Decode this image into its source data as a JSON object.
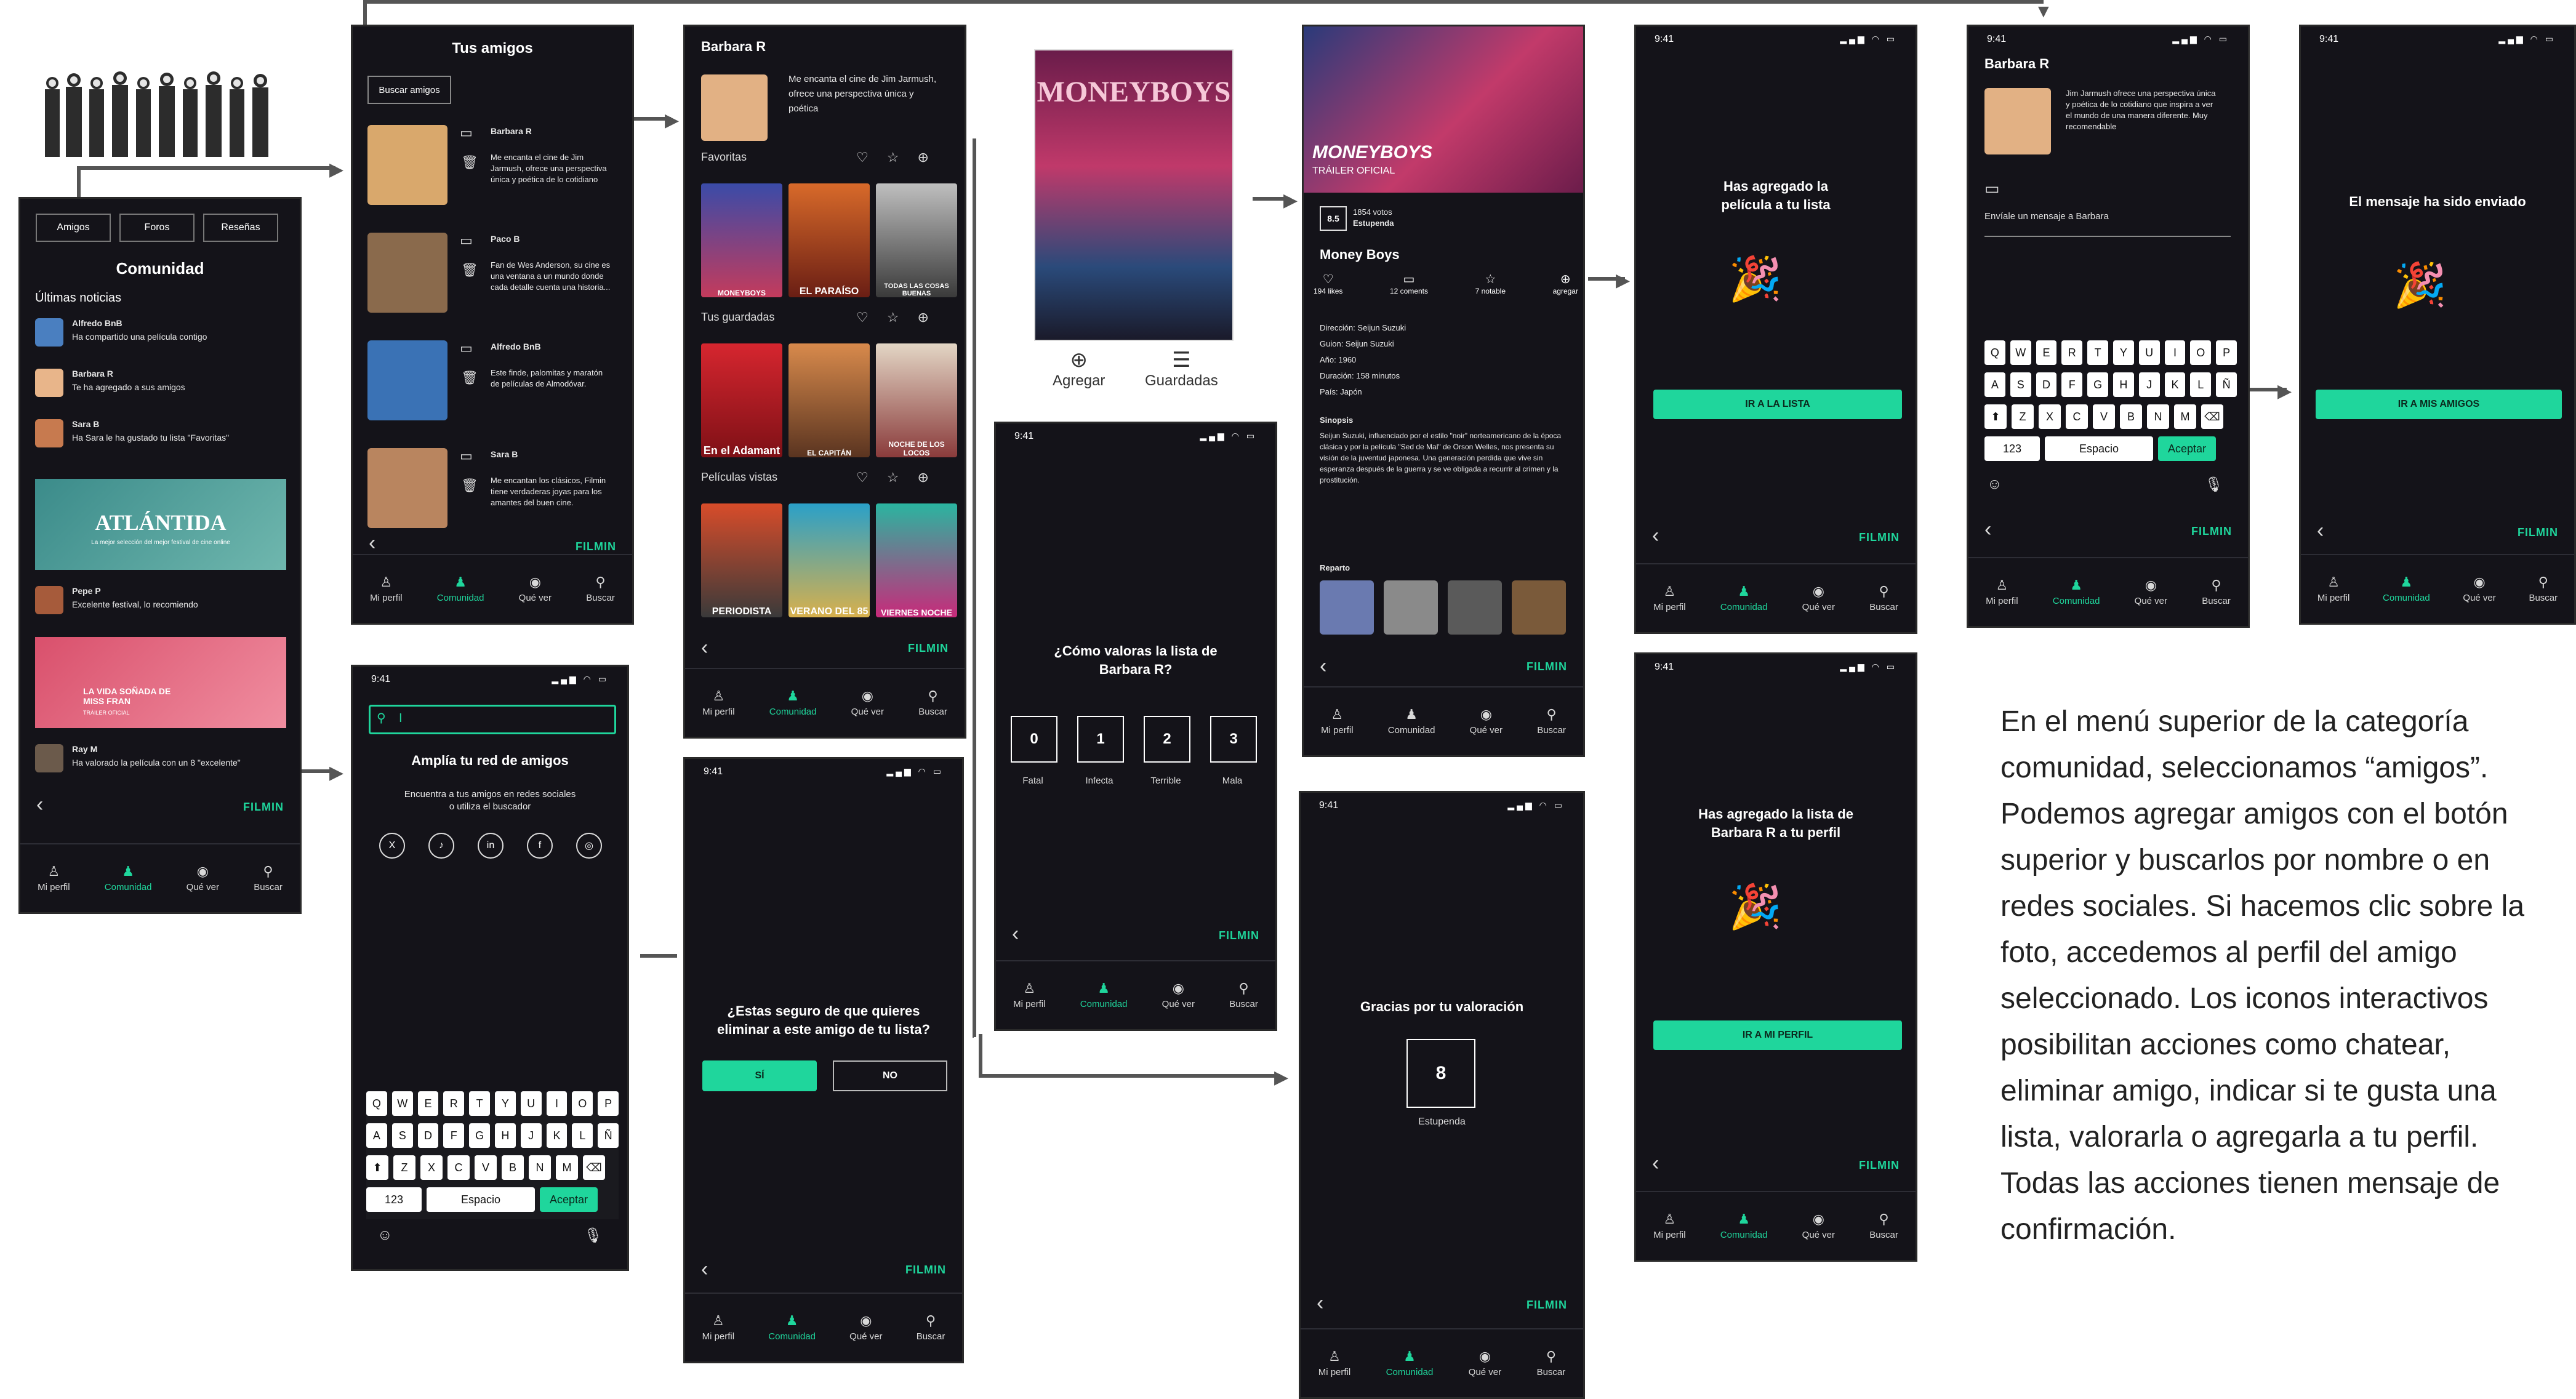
{
  "screen_main": {
    "tabs": [
      "Amigos",
      "Foros",
      "Reseñas"
    ],
    "title": "Comunidad",
    "subtitle": "Últimas noticias",
    "news": [
      {
        "name": "Alfredo BnB",
        "text": "Ha compartido una película contigo"
      },
      {
        "name": "Barbara R",
        "text": "Te ha agregado a sus amigos"
      },
      {
        "name": "Sara B",
        "text": "Ha Sara le ha gustado tu lista \"Favoritas\""
      }
    ],
    "banner1": "ATLÁNTIDA",
    "banner1_sub": "La mejor selección del mejor festival de cine online",
    "news2": {
      "name": "Pepe P",
      "text": "Excelente festival, lo recomiendo"
    },
    "banner2": "LA VIDA SOÑADA DE MISS FRAN",
    "banner2_sub": "TRÁILER OFICIAL",
    "news3": {
      "name": "Ray M",
      "text": "Ha valorado la película con un 8 \"excelente\""
    }
  },
  "nav": {
    "perfil": "Mi perfil",
    "comunidad": "Comunidad",
    "quever": "Qué ver",
    "buscar": "Buscar"
  },
  "nav_icons": {
    "perfil": "person-icon",
    "comunidad": "group-icon",
    "quever": "eye-icon",
    "buscar": "search-icon"
  },
  "brand": "FILMIN",
  "friends": {
    "title": "Tus amigos",
    "search": "Buscar amigos",
    "list": [
      {
        "name": "Barbara R",
        "text": "Me encanta el cine de Jim Jarmush, ofrece una perspectiva única y poética de lo cotidiano"
      },
      {
        "name": "Paco B",
        "text": "Fan de Wes Anderson, su cine es una ventana a un mundo donde cada detalle cuenta una historia..."
      },
      {
        "name": "Alfredo BnB",
        "text": "Este finde, palomitas y maratón de películas de Almodóvar."
      },
      {
        "name": "Sara B",
        "text": "Me encantan los clásicos, Filmin tiene verdaderas joyas para los amantes del buen cine."
      }
    ]
  },
  "add_friends": {
    "time": "9:41",
    "input": "I",
    "title": "Amplía tu red de amigos",
    "text": "Encuentra a tus amigos en redes sociales o utiliza el buscador",
    "keys_row1": [
      "Q",
      "W",
      "E",
      "R",
      "T",
      "Y",
      "U",
      "I",
      "O",
      "P"
    ],
    "keys_row2": [
      "A",
      "S",
      "D",
      "F",
      "G",
      "H",
      "J",
      "K",
      "L",
      "Ñ"
    ],
    "keys_row3": [
      "Z",
      "X",
      "C",
      "V",
      "B",
      "N",
      "M"
    ],
    "k123": "123",
    "kspace": "Espacio",
    "kok": "Aceptar"
  },
  "profile": {
    "name": "Barbara R",
    "bio": "Me encanta el cine de Jim Jarmush, ofrece una perspectiva única y poética",
    "favoritas": "Favoritas",
    "guardadas": "Tus guardadas",
    "vistas": "Películas vistas",
    "posters_fav": [
      "MONEYBOYS",
      "EL PARAÍSO",
      "TODAS LAS COSAS BUENAS"
    ],
    "posters_sav": [
      "En el Adamant",
      "EL CAPITÁN",
      "NOCHE DE LOS LOCOS"
    ],
    "posters_vis": [
      "PERIODISTA",
      "VERANO DEL 85",
      "VIERNES NOCHE"
    ]
  },
  "delete": {
    "time": "9:41",
    "question": "¿Estas seguro de que quieres eliminar a este amigo de tu lista?",
    "yes": "SÍ",
    "no": "NO"
  },
  "poster_big": {
    "title": "MONEYBOYS",
    "add": "Agregar",
    "saved": "Guardadas"
  },
  "rate_list": {
    "time": "9:41",
    "question": "¿Cómo valoras la lista de Barbara R?",
    "values": [
      "0",
      "1",
      "2",
      "3"
    ],
    "labels": [
      "Fatal",
      "Infecta",
      "Terrible",
      "Mala"
    ]
  },
  "movie": {
    "poster_title": "MONEYBOYS",
    "trailer": "TRÁILER OFICIAL",
    "score": "8.5",
    "votes": "1854 votos",
    "verdict": "Estupenda",
    "title": "Money Boys",
    "stats": [
      "194 likes",
      "12 coments",
      "7 notable",
      "agregar"
    ],
    "direccion": "Dirección: Seijun Suzuki",
    "guion": "Guion: Seijun Suzuki",
    "anio": "Año: 1960",
    "duracion": "Duración: 158 minutos",
    "pais": "País: Japón",
    "sinopsis_t": "Sinopsis",
    "sinopsis": "Seijun Suzuki, influenciado por el estilo \"noir\" norteamericano de la época clásica y por la película \"Sed de Mal\" de Orson Welles, nos presenta su visión de la juventud japonesa. Una generación perdida que vive sin esperanza después de la guerra y se ve obligada a recurrir al crimen y la prostitución.",
    "reparto": "Reparto"
  },
  "thanks": {
    "time": "9:41",
    "title": "Gracias por tu valoración",
    "score": "8",
    "verdict": "Estupenda"
  },
  "added_movie": {
    "time": "9:41",
    "title": "Has agregado la película a tu lista",
    "btn": "IR A LA LISTA"
  },
  "added_list": {
    "time": "9:41",
    "title": "Has agregado la lista de Barbara R a tu perfil",
    "btn": "IR A MI PERFIL"
  },
  "message": {
    "time": "9:41",
    "name": "Barbara R",
    "bio": "Jim Jarmush ofrece una perspectiva única y poética de lo cotidiano que inspira a ver el mundo de una manera diferente. Muy recomendable",
    "placeholder": "Envíale un mensaje a Barbara"
  },
  "sent": {
    "time": "9:41",
    "title": "El mensaje ha sido enviado",
    "btn": "IR A MIS AMIGOS"
  },
  "description": "En el menú superior de la categoría comunidad, seleccionamos “amigos”. Podemos agregar amigos con el botón superior y buscarlos por nombre o en redes sociales. Si hacemos clic sobre la foto, accedemos al perfil del amigo seleccionado. Los iconos interactivos posibilitan acciones como chatear, eliminar amigo, indicar si te gusta una lista, valorarla o agregarla a tu perfil. Todas las acciones tienen mensaje de confirmación.",
  "colors": {
    "accent": "#1fd69c",
    "bg": "#141319"
  }
}
